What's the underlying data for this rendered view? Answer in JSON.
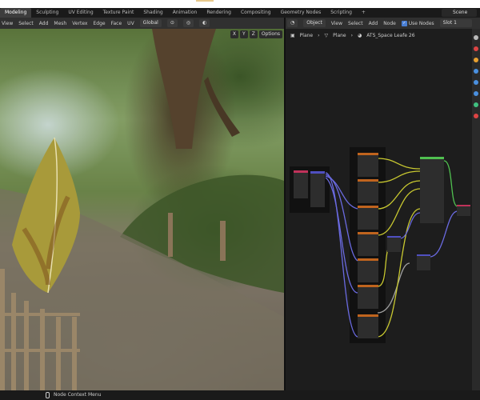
{
  "workspace_tabs": [
    "Modeling",
    "Sculpting",
    "UV Editing",
    "Texture Paint",
    "Shading",
    "Animation",
    "Rendering",
    "Compositing",
    "Geometry Nodes",
    "Scripting",
    "+"
  ],
  "active_tab": "Modeling",
  "scene": "Scene",
  "viewport_header": {
    "menus": [
      "View",
      "Select",
      "Add",
      "Mesh",
      "Vertex",
      "Edge",
      "Face",
      "UV"
    ],
    "transform_orientation": "Global",
    "axes": [
      "X",
      "Y",
      "Z"
    ],
    "options": "Options"
  },
  "node_header": {
    "mode": "Object",
    "menus": [
      "View",
      "Select",
      "Add",
      "Node"
    ],
    "use_nodes": "Use Nodes",
    "use_nodes_checked": true,
    "slot": "Slot 1"
  },
  "breadcrumb": [
    "Plane",
    "Plane",
    "ATS_Space Leafe 26"
  ],
  "status": {
    "hint": "Node Context Menu"
  },
  "colors": {
    "link_purple": "#6a6ae0",
    "link_yellow": "#c8c830",
    "link_gray": "#a0a0a0",
    "link_green": "#50c050",
    "node_header_orange": "#c0641e"
  }
}
